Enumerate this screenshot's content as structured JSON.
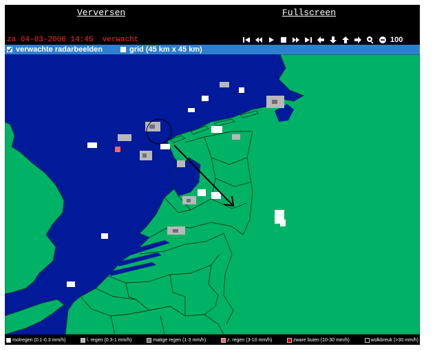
{
  "header": {
    "refresh_label": "Verversen",
    "fullscreen_label": "Fullscreen"
  },
  "status": {
    "timestamp": "za 04-03-2006 14:45  verwacht"
  },
  "controls": {
    "zoom_value": "100",
    "icons": [
      "skip-start-icon",
      "rewind-icon",
      "play-icon",
      "stop-icon",
      "fast-forward-icon",
      "skip-end-icon",
      "pan-left-icon",
      "pan-down-icon",
      "pan-up-icon",
      "pan-right-icon",
      "zoom-in-icon",
      "zoom-out-icon"
    ]
  },
  "options": {
    "radar_label": "verwachte radarbeelden",
    "radar_checked": true,
    "grid_label": "grid (45 km x 45 km)",
    "grid_checked": false
  },
  "colors": {
    "sea": "#001a99",
    "land": "#00b266",
    "border": "#0a3a20",
    "option_bar": "#2f7fd0",
    "timestamp": "#ff2a2a"
  },
  "legend": [
    {
      "label": "motregen (0.1-0.3 mm/h)",
      "color": "#ffffff"
    },
    {
      "label": "l. regen (0.3-1 mm/h)",
      "color": "#b8b8b8"
    },
    {
      "label": "matige regen (1-3 mm/h)",
      "color": "#707070"
    },
    {
      "label": "z. regen (3-10 mm/h)",
      "color": "#ff6666"
    },
    {
      "label": "zware buien (10-30 mm/h)",
      "color": "#cc0000"
    },
    {
      "label": "wolkbreuk (>30 mm/h)",
      "color": "#000000"
    }
  ]
}
